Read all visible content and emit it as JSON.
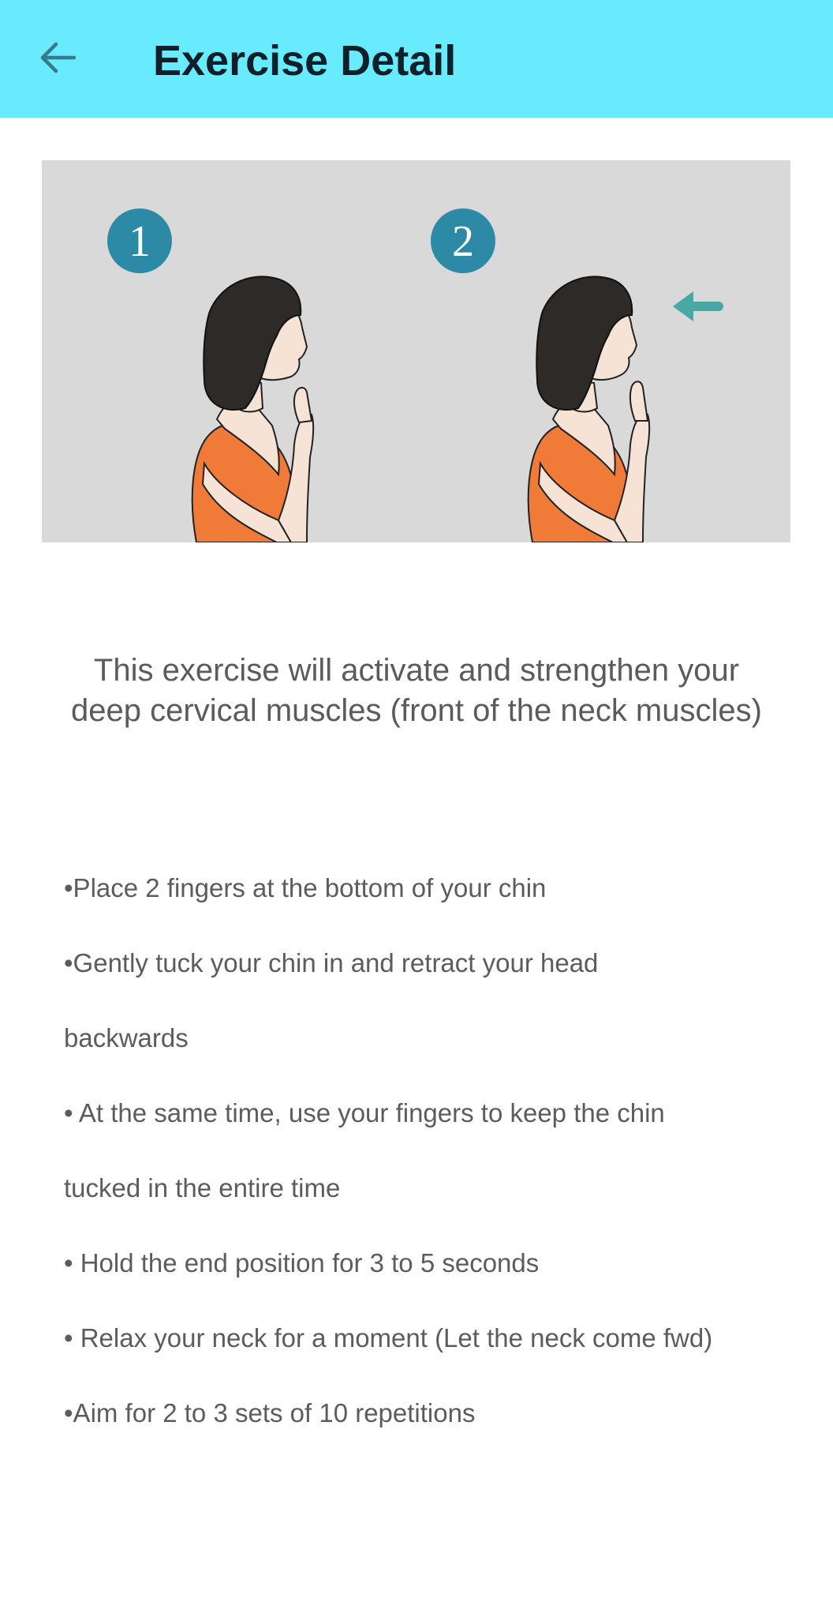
{
  "header": {
    "back_icon": "arrow-left-icon",
    "title": "Exercise Detail",
    "background": "#67ebfd"
  },
  "illustration": {
    "step_1_label": "1",
    "step_2_label": "2",
    "badge_color": "#2d8aa6",
    "arrow_color": "#4aa7a3",
    "shirt_color": "#f07a37",
    "background": "#d9d9d9"
  },
  "description": "This exercise will activate and strengthen your deep cervical muscles (front of the neck muscles)",
  "steps": [
    "•Place 2 fingers at the bottom of your chin",
    "•Gently tuck your chin in and retract your head",
    "backwards",
    "• At the same time, use your fingers to keep the chin",
    "tucked in the entire time",
    "• Hold the end position for 3 to 5 seconds",
    "• Relax your neck for a moment (Let the neck come fwd)",
    "•Aim for 2 to 3 sets of 10 repetitions"
  ]
}
